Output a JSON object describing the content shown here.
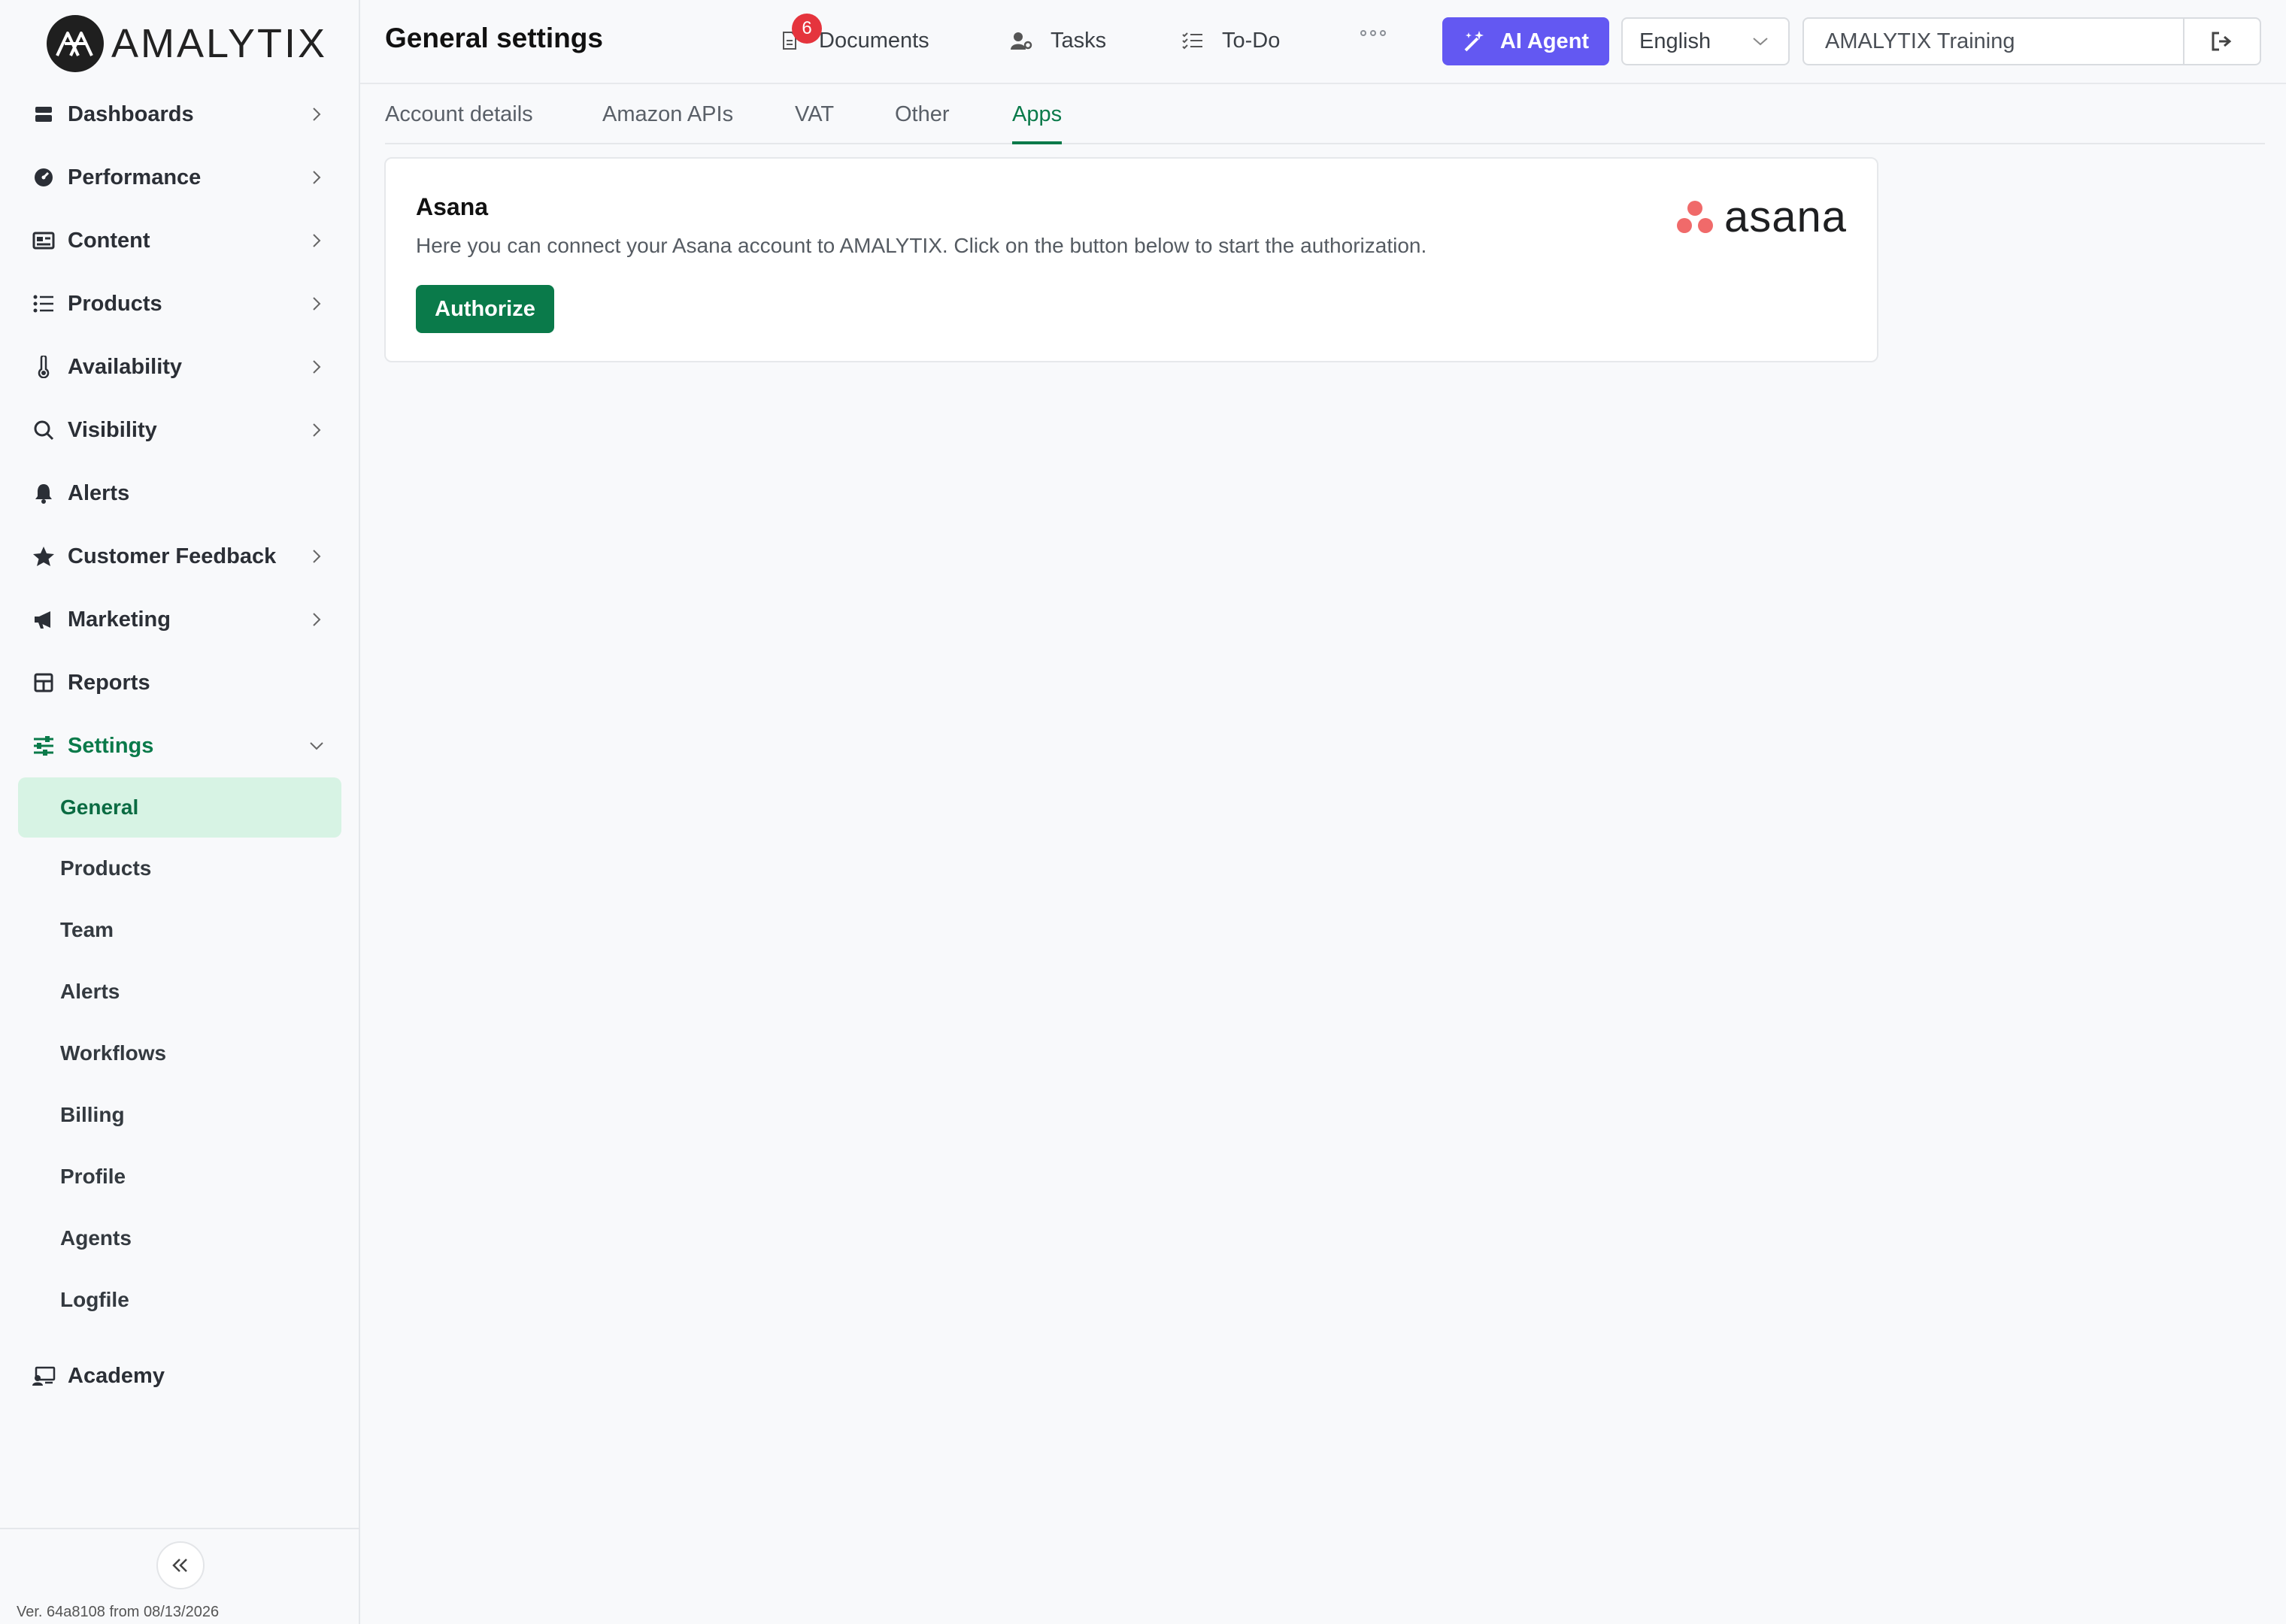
{
  "brand": {
    "logo_text": "AMALYTIX"
  },
  "sidebar": {
    "items": [
      {
        "label": "Dashboards",
        "icon": "dashboard-icon",
        "has_children": true
      },
      {
        "label": "Performance",
        "icon": "gauge-icon",
        "has_children": true
      },
      {
        "label": "Content",
        "icon": "content-icon",
        "has_children": true
      },
      {
        "label": "Products",
        "icon": "list-icon",
        "has_children": true
      },
      {
        "label": "Availability",
        "icon": "thermometer-icon",
        "has_children": true
      },
      {
        "label": "Visibility",
        "icon": "search-icon",
        "has_children": true
      },
      {
        "label": "Alerts",
        "icon": "bell-icon",
        "has_children": false
      },
      {
        "label": "Customer Feedback",
        "icon": "star-icon",
        "has_children": true
      },
      {
        "label": "Marketing",
        "icon": "megaphone-icon",
        "has_children": true
      },
      {
        "label": "Reports",
        "icon": "table-icon",
        "has_children": false
      },
      {
        "label": "Settings",
        "icon": "sliders-icon",
        "has_children": true,
        "expanded": true
      }
    ],
    "settings_children": [
      "General",
      "Products",
      "Team",
      "Alerts",
      "Workflows",
      "Billing",
      "Profile",
      "Agents",
      "Logfile"
    ],
    "selected_child": "General",
    "academy": {
      "label": "Academy",
      "icon": "academy-icon"
    },
    "version": "Ver. 64a8108 from 08/13/2026"
  },
  "header": {
    "title": "General settings",
    "documents_label": "Documents",
    "documents_badge": "6",
    "tasks_label": "Tasks",
    "todo_label": "To-Do",
    "ai_agent_label": "AI Agent",
    "language": "English",
    "account": "AMALYTIX Training"
  },
  "tabs": [
    "Account details",
    "Amazon APIs",
    "VAT",
    "Other",
    "Apps"
  ],
  "active_tab": "Apps",
  "card": {
    "title": "Asana",
    "description": "Here you can connect your Asana account to AMALYTIX. Click on the button below to start the authorization.",
    "button_label": "Authorize",
    "logo_text": "asana"
  },
  "colors": {
    "accent_green": "#0a7a4a",
    "ai_purple": "#6358f2",
    "badge_red": "#e5343d",
    "asana_coral": "#f06a6a"
  }
}
